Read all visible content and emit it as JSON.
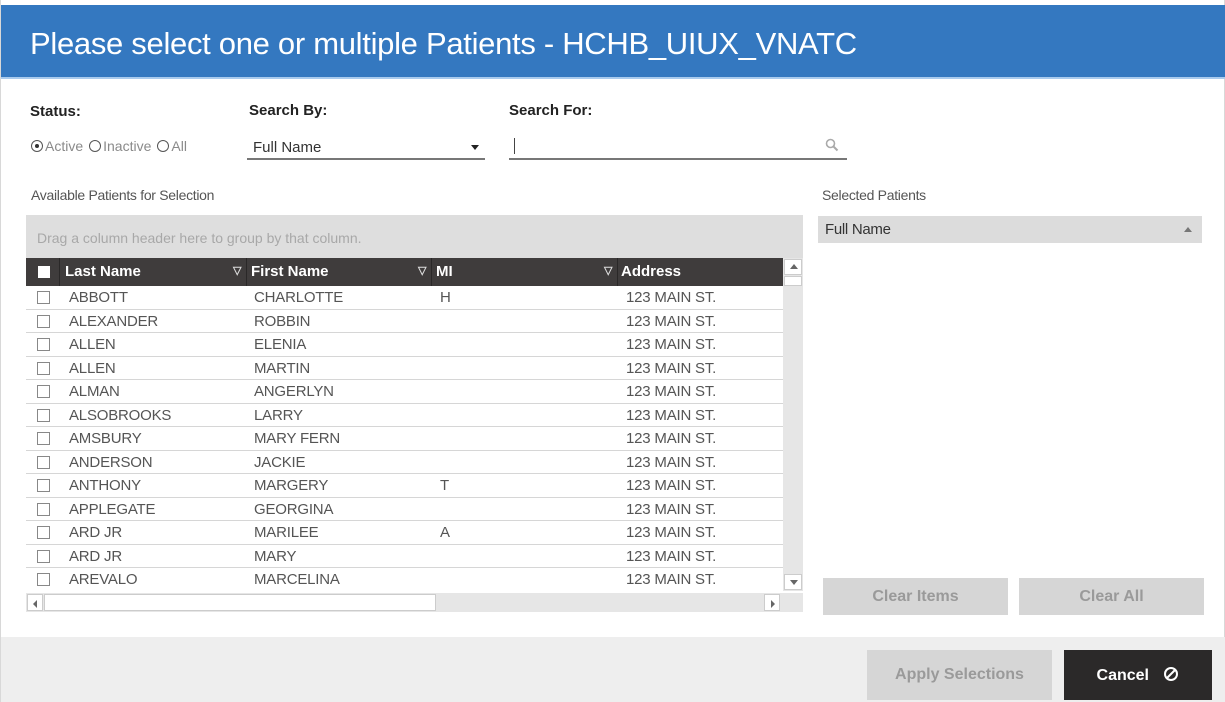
{
  "dialog": {
    "title": "Please select one or multiple Patients - HCHB_UIUX_VNATC"
  },
  "filters": {
    "status_label": "Status:",
    "status_options": [
      {
        "label": "Active",
        "selected": true
      },
      {
        "label": "Inactive",
        "selected": false
      },
      {
        "label": "All",
        "selected": false
      }
    ],
    "search_by_label": "Search By:",
    "search_by_value": "Full Name",
    "search_for_label": "Search For:",
    "search_for_value": ""
  },
  "available": {
    "label": "Available Patients for Selection",
    "group_hint": "Drag a column header here to group by that column.",
    "columns": [
      "Last Name",
      "First Name",
      "MI",
      "Address"
    ],
    "rows": [
      {
        "last": "ABBOTT",
        "first": "CHARLOTTE",
        "mi": "H",
        "address": "123 MAIN ST."
      },
      {
        "last": "ALEXANDER",
        "first": "ROBBIN",
        "mi": "",
        "address": "123 MAIN ST."
      },
      {
        "last": "ALLEN",
        "first": "ELENIA",
        "mi": "",
        "address": "123 MAIN ST."
      },
      {
        "last": "ALLEN",
        "first": "MARTIN",
        "mi": "",
        "address": "123 MAIN ST."
      },
      {
        "last": "ALMAN",
        "first": "ANGERLYN",
        "mi": "",
        "address": "123 MAIN ST."
      },
      {
        "last": "ALSOBROOKS",
        "first": "LARRY",
        "mi": "",
        "address": "123 MAIN ST."
      },
      {
        "last": "AMSBURY",
        "first": "MARY FERN",
        "mi": "",
        "address": "123 MAIN ST."
      },
      {
        "last": "ANDERSON",
        "first": "JACKIE",
        "mi": "",
        "address": "123 MAIN ST."
      },
      {
        "last": "ANTHONY",
        "first": "MARGERY",
        "mi": "T",
        "address": "123 MAIN ST."
      },
      {
        "last": "APPLEGATE",
        "first": "GEORGINA",
        "mi": "",
        "address": "123 MAIN ST."
      },
      {
        "last": "ARD JR",
        "first": "MARILEE",
        "mi": "A",
        "address": "123 MAIN ST."
      },
      {
        "last": "ARD JR",
        "first": "MARY",
        "mi": "",
        "address": "123 MAIN ST."
      },
      {
        "last": "AREVALO",
        "first": "MARCELINA",
        "mi": "",
        "address": "123 MAIN ST."
      }
    ]
  },
  "selected": {
    "label": "Selected Patients",
    "column": "Full Name",
    "clear_items_label": "Clear Items",
    "clear_all_label": "Clear All"
  },
  "footer": {
    "apply_label": "Apply Selections",
    "cancel_label": "Cancel"
  }
}
